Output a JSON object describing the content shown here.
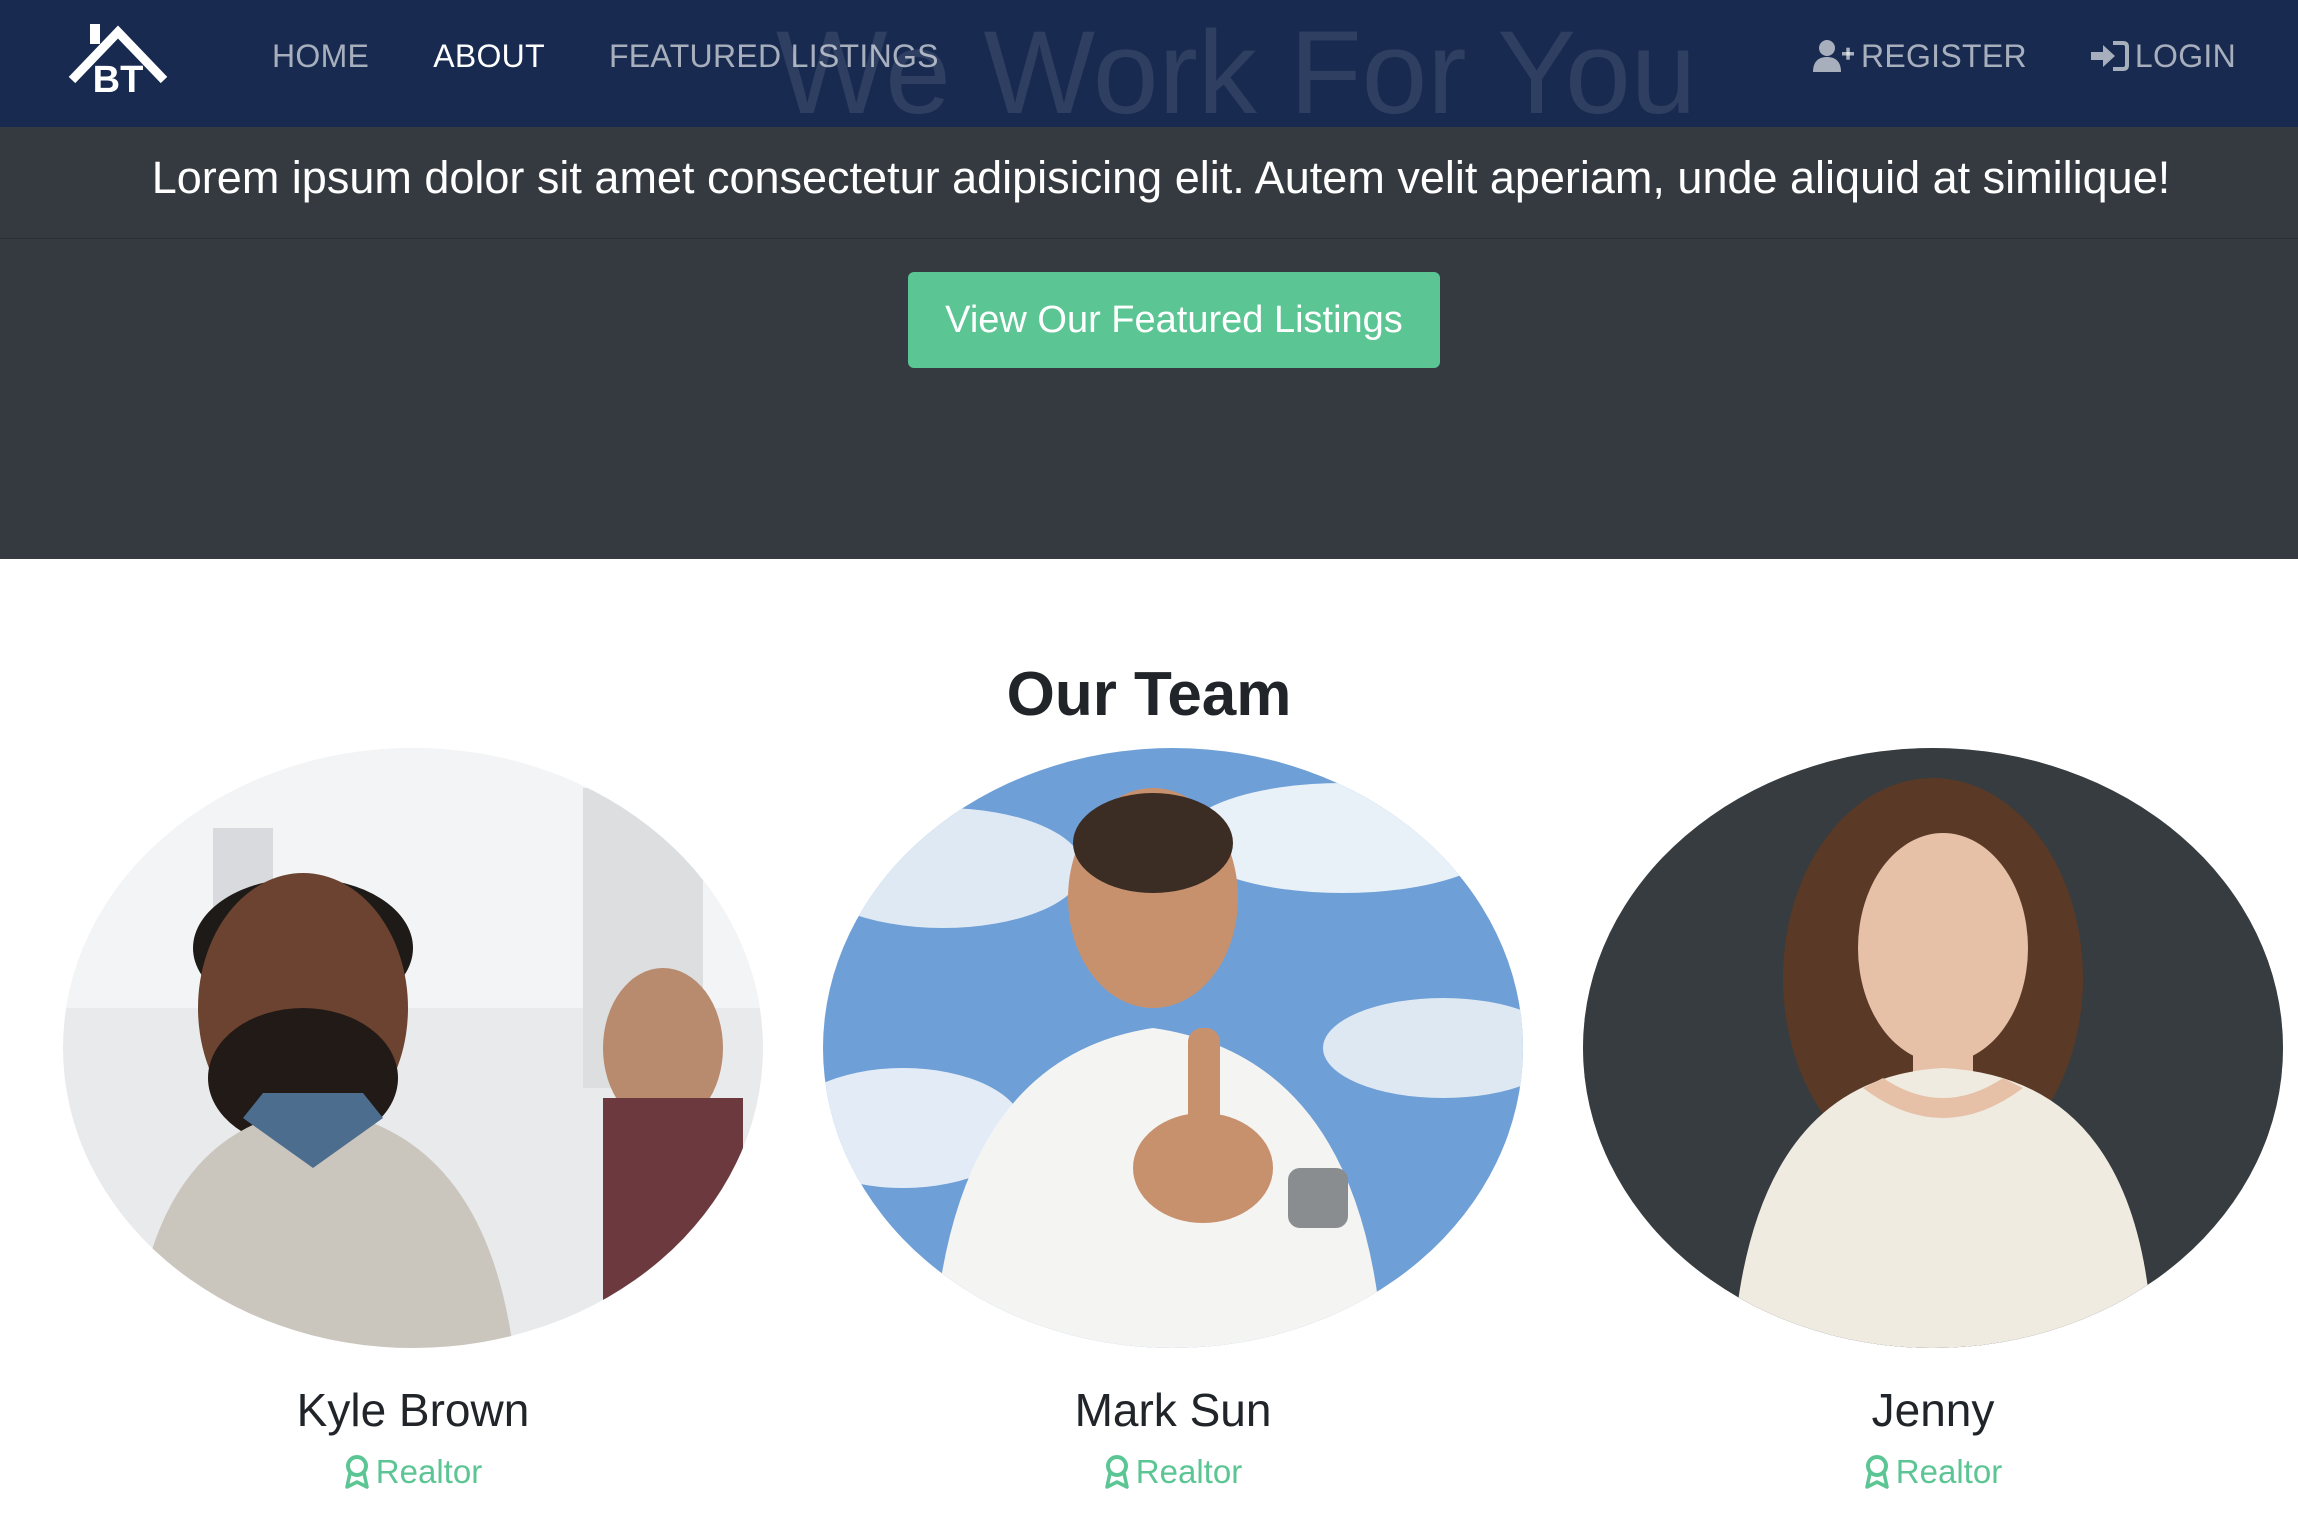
{
  "nav": {
    "brand_text": "BT",
    "links": [
      {
        "label": "HOME",
        "active": false
      },
      {
        "label": "ABOUT",
        "active": true
      },
      {
        "label": "FEATURED LISTINGS",
        "active": false
      }
    ],
    "register_label": "REGISTER",
    "login_label": "LOGIN",
    "register_icon": "user-plus-icon",
    "login_icon": "sign-in-icon"
  },
  "hero": {
    "background_heading": "We Work For You",
    "lead": "Lorem ipsum dolor sit amet consectetur adipisicing elit. Autem velit aperiam, unde aliquid at similique!",
    "cta_label": "View Our Featured Listings"
  },
  "team": {
    "title": "Our Team",
    "members": [
      {
        "name": "Kyle Brown",
        "role": "Realtor",
        "role_icon": "award-icon"
      },
      {
        "name": "Mark Sun",
        "role": "Realtor",
        "role_icon": "award-icon"
      },
      {
        "name": "Jenny",
        "role": "Realtor",
        "role_icon": "award-icon"
      }
    ]
  },
  "colors": {
    "navbar": "#182a50",
    "hero": "#343a40",
    "accent": "#5cc594",
    "text_dark": "#212529"
  }
}
